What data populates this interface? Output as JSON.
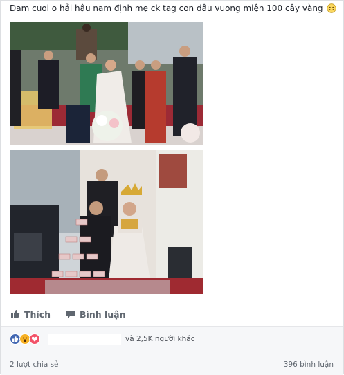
{
  "post": {
    "text": "Dam cuoi o hải hậu nam định mẹ ck tag con dâu vuong miện 100 cây vàng",
    "emoji_icon": "smiley-face-icon"
  },
  "photos": [
    {
      "alt_icon": "wedding-crowning-photo"
    },
    {
      "alt_icon": "wedding-champagne-tower-photo"
    }
  ],
  "actions": {
    "like_label": "Thích",
    "comment_label": "Bình luận"
  },
  "reactions": {
    "icons": [
      "like-icon",
      "wow-icon",
      "love-icon"
    ],
    "others_text": "và 2,5K người khác",
    "shares_text": "2 lượt chia sẻ",
    "comments_text": "396 bình luận"
  },
  "colors": {
    "like_blue": "#4267b2",
    "wow_yellow": "#f7b125",
    "love_red": "#f25268",
    "muted_text": "#606770"
  }
}
